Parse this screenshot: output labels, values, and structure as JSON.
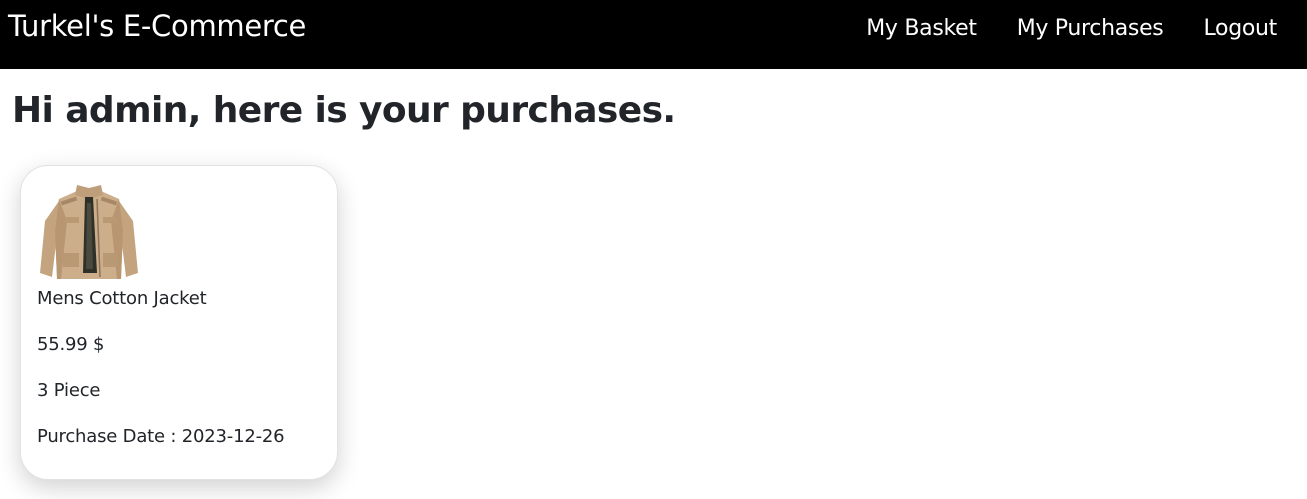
{
  "navbar": {
    "brand": "Turkel's E-Commerce",
    "links": [
      {
        "label": "My Basket"
      },
      {
        "label": "My Purchases"
      },
      {
        "label": "Logout"
      }
    ]
  },
  "page": {
    "heading": "Hi admin, here is your purchases."
  },
  "purchases": [
    {
      "image_icon": "jacket-image",
      "title": "Mens Cotton Jacket",
      "price": "55.99 $",
      "quantity": "3 Piece",
      "purchase_date": "Purchase Date : 2023-12-26"
    }
  ],
  "colors": {
    "navbar_bg": "#000000",
    "navbar_text": "#ffffff",
    "body_text": "#212529",
    "jacket": "#c9ab86"
  }
}
